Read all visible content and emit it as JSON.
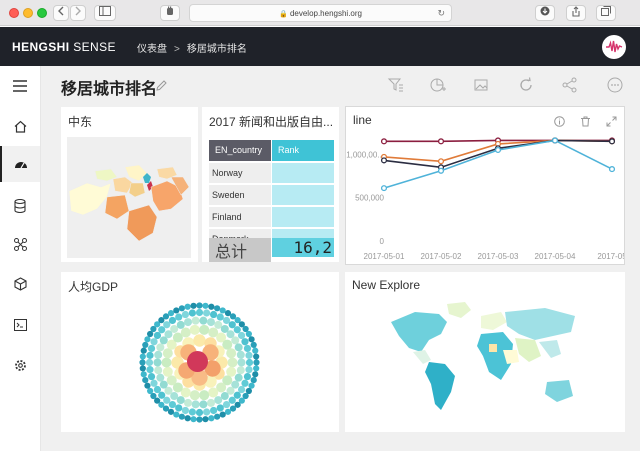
{
  "browser": {
    "url": "develop.hengshi.org"
  },
  "header": {
    "brand_bold": "HENGSHI",
    "brand_rest": " SENSE",
    "crumb_root": "仪表盘",
    "crumb_sep": ">",
    "crumb_current": "移居城市排名"
  },
  "sidebar": {
    "items": [
      "menu-icon",
      "home-icon",
      "dashboard-icon",
      "database-icon",
      "connect-icon",
      "cube-icon",
      "terminal-icon",
      "settings-icon"
    ]
  },
  "page": {
    "title": "移居城市排名"
  },
  "cards": {
    "mideast": {
      "title": "中东"
    },
    "freedom": {
      "title": "2017 新闻和出版自由...",
      "col1": "EN_country",
      "col2": "Rank",
      "rows": [
        "Norway",
        "Sweden",
        "Finland",
        "Denmark"
      ],
      "total_label": "总计",
      "total_value": "16,2"
    },
    "line": {
      "title": "line",
      "colors": [
        "#8b1e3f",
        "#e07b39",
        "#2b2d42",
        "#4fb3d9"
      ]
    },
    "gdp": {
      "title": "人均GDP"
    },
    "explore": {
      "title": "New Explore"
    }
  },
  "chart_data": {
    "type": "line",
    "title": "line",
    "x": [
      "2017-05-01",
      "2017-05-02",
      "2017-05-03",
      "2017-05-04",
      "2017-05"
    ],
    "y_ticks": [
      "0",
      "500,000",
      "1,000,00..."
    ],
    "ylim": [
      0,
      1200000
    ],
    "grid": false,
    "series": [
      {
        "values": [
          1150000,
          1150000,
          1160000,
          1160000,
          1160000
        ]
      },
      {
        "values": [
          970000,
          920000,
          1120000,
          1160000,
          1150000
        ]
      },
      {
        "values": [
          930000,
          850000,
          1070000,
          1160000,
          1150000
        ]
      },
      {
        "values": [
          610000,
          810000,
          1050000,
          1160000,
          830000
        ]
      }
    ]
  }
}
